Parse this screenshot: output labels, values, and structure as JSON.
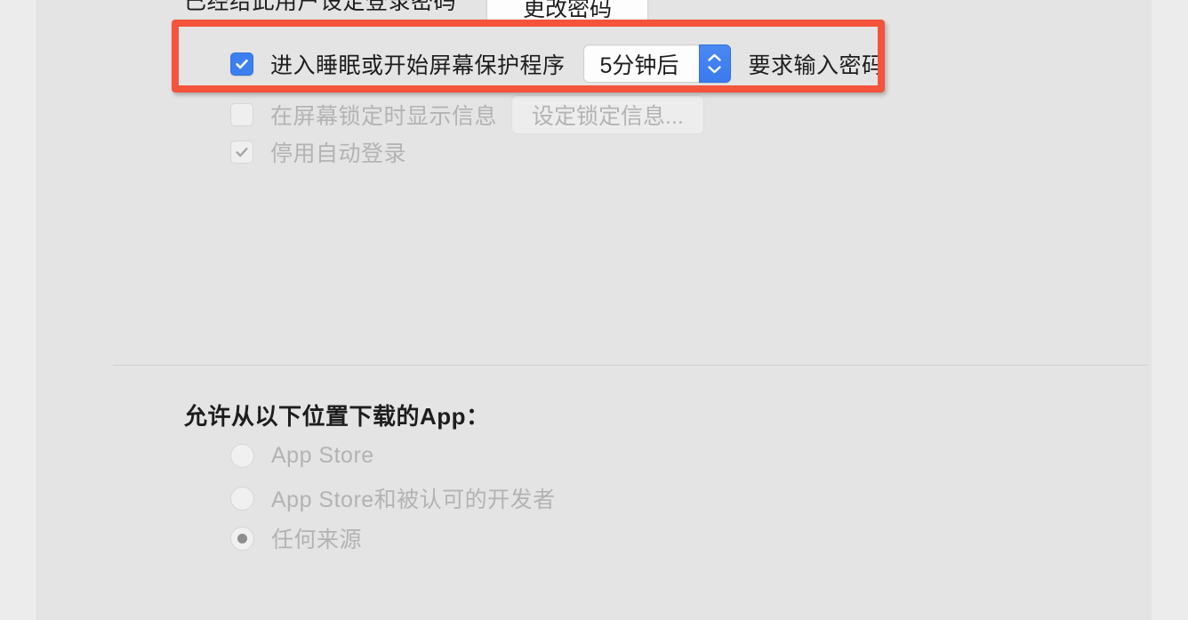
{
  "window": {
    "accent_blue": "#3c7ff0",
    "highlight_red": "#f4533c",
    "panel_background": "#e4e4e4",
    "window_background": "#ececec"
  },
  "security_section": {
    "password_set_text": "已经给此用户设定登录密码",
    "change_password_button": "更改密码",
    "sleep_password": {
      "label": "进入睡眠或开始屏幕保护程序",
      "delay_value": "5分钟后",
      "trailing_label": "要求输入密码",
      "checked": true,
      "stepper_up_icon": "chevron-up-icon",
      "stepper_down_icon": "chevron-down-icon"
    },
    "lock_message": {
      "label": "在屏幕锁定时显示信息",
      "button_label": "设定锁定信息...",
      "checked": false,
      "disabled": true
    },
    "disable_autologin": {
      "label": "停用自动登录",
      "checked": true,
      "disabled": true
    }
  },
  "app_download_section": {
    "heading": "允许从以下位置下载的App：",
    "options": [
      {
        "label": "App Store",
        "selected": false
      },
      {
        "label": "App Store和被认可的开发者",
        "selected": false
      },
      {
        "label": "任何来源",
        "selected": true
      }
    ]
  }
}
